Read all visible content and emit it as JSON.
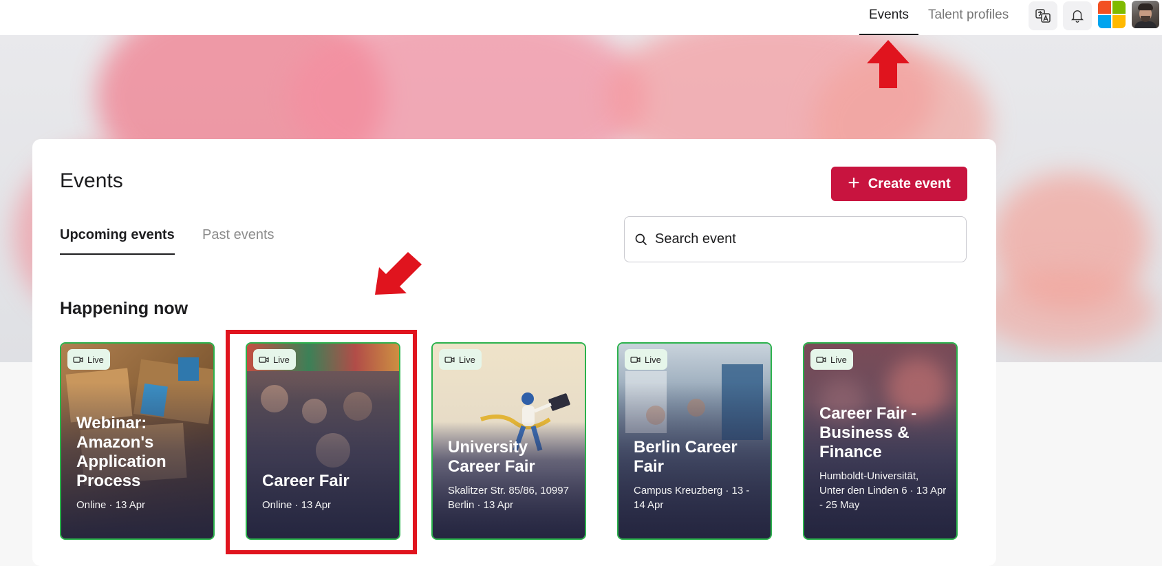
{
  "nav": {
    "tabs": [
      {
        "label": "Events",
        "active": true
      },
      {
        "label": "Talent profiles",
        "active": false
      }
    ],
    "icons": [
      "translate-icon",
      "bell-icon",
      "company-logo",
      "user-avatar"
    ]
  },
  "page": {
    "title": "Events",
    "create_button": "Create event",
    "tabs": [
      {
        "label": "Upcoming events",
        "active": true
      },
      {
        "label": "Past events",
        "active": false
      }
    ],
    "search": {
      "placeholder": "Search event",
      "value": ""
    },
    "section_title": "Happening now"
  },
  "events": [
    {
      "badge": "Live",
      "title": "Webinar: Amazon's Application Process",
      "meta": "Online · 13 Apr"
    },
    {
      "badge": "Live",
      "title": "Career Fair",
      "meta": "Online · 13 Apr"
    },
    {
      "badge": "Live",
      "title": "University Career Fair",
      "meta": "Skalitzer Str. 85/86, 10997 Berlin · 13 Apr"
    },
    {
      "badge": "Live",
      "title": "Berlin Career Fair",
      "meta": "Campus Kreuzberg · 13 - 14 Apr"
    },
    {
      "badge": "Live",
      "title": "Career Fair - Business & Finance",
      "meta": "Humboldt-Universität, Unter den Linden 6 · 13 Apr - 25 May"
    }
  ],
  "colors": {
    "accent": "#c8143f",
    "live_border": "#2bb24c",
    "annotation": "#e0141e"
  }
}
